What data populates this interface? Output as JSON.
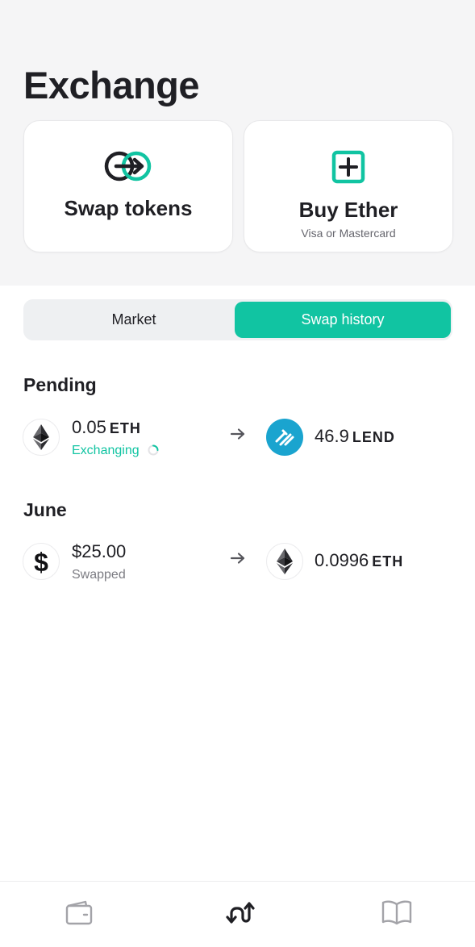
{
  "header": {
    "title": "Exchange"
  },
  "actions": {
    "swap": {
      "label": "Swap tokens",
      "icon": "swap-arrow-icon"
    },
    "buy": {
      "label": "Buy Ether",
      "subtitle": "Visa or Mastercard",
      "icon": "plus-square-icon"
    }
  },
  "tabs": {
    "market": "Market",
    "history": "Swap history",
    "active": "history"
  },
  "sections": {
    "pending": {
      "title": "Pending",
      "tx": {
        "from_amount": "0.05",
        "from_unit": "ETH",
        "from_icon": "ethereum-icon",
        "status": "Exchanging",
        "to_amount": "46.9",
        "to_unit": "LEND",
        "to_icon": "lend-icon"
      }
    },
    "june": {
      "title": "June",
      "tx": {
        "from_amount": "$25.00",
        "from_icon": "dollar-icon",
        "status": "Swapped",
        "to_amount": "0.0996",
        "to_unit": "ETH",
        "to_icon": "ethereum-icon"
      }
    }
  },
  "bottom_nav": {
    "items": [
      "wallet-icon",
      "exchange-icon",
      "book-icon"
    ],
    "active": "exchange-icon"
  },
  "colors": {
    "accent": "#11c4a2",
    "lend": "#1aa4cf",
    "text": "#1f1f24"
  }
}
